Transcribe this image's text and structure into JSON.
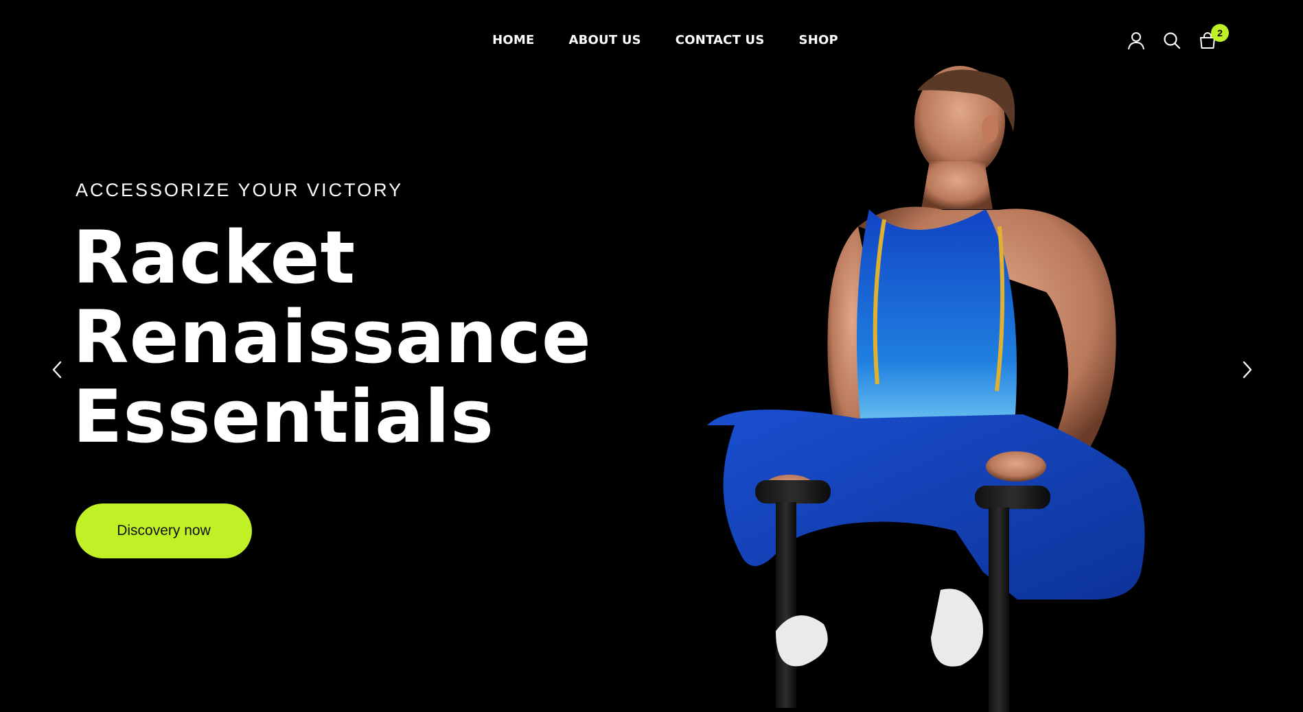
{
  "nav": {
    "items": [
      {
        "label": "HOME"
      },
      {
        "label": "ABOUT US"
      },
      {
        "label": "CONTACT US"
      },
      {
        "label": "SHOP"
      }
    ]
  },
  "header_icons": {
    "account": "user-icon",
    "search": "search-icon",
    "cart": "shopping-bag-icon",
    "cart_count": "2"
  },
  "hero": {
    "eyebrow": "ACCESSORIZE YOUR VICTORY",
    "headline_lines": [
      "Racket",
      "Renaissance",
      "Essentials"
    ],
    "cta_label": "Discovery now",
    "prev_icon": "chevron-left-icon",
    "next_icon": "chevron-right-icon"
  },
  "colors": {
    "background": "#000000",
    "accent": "#c0f026",
    "text": "#ffffff",
    "outfit_blue": "#1e5bd6"
  }
}
